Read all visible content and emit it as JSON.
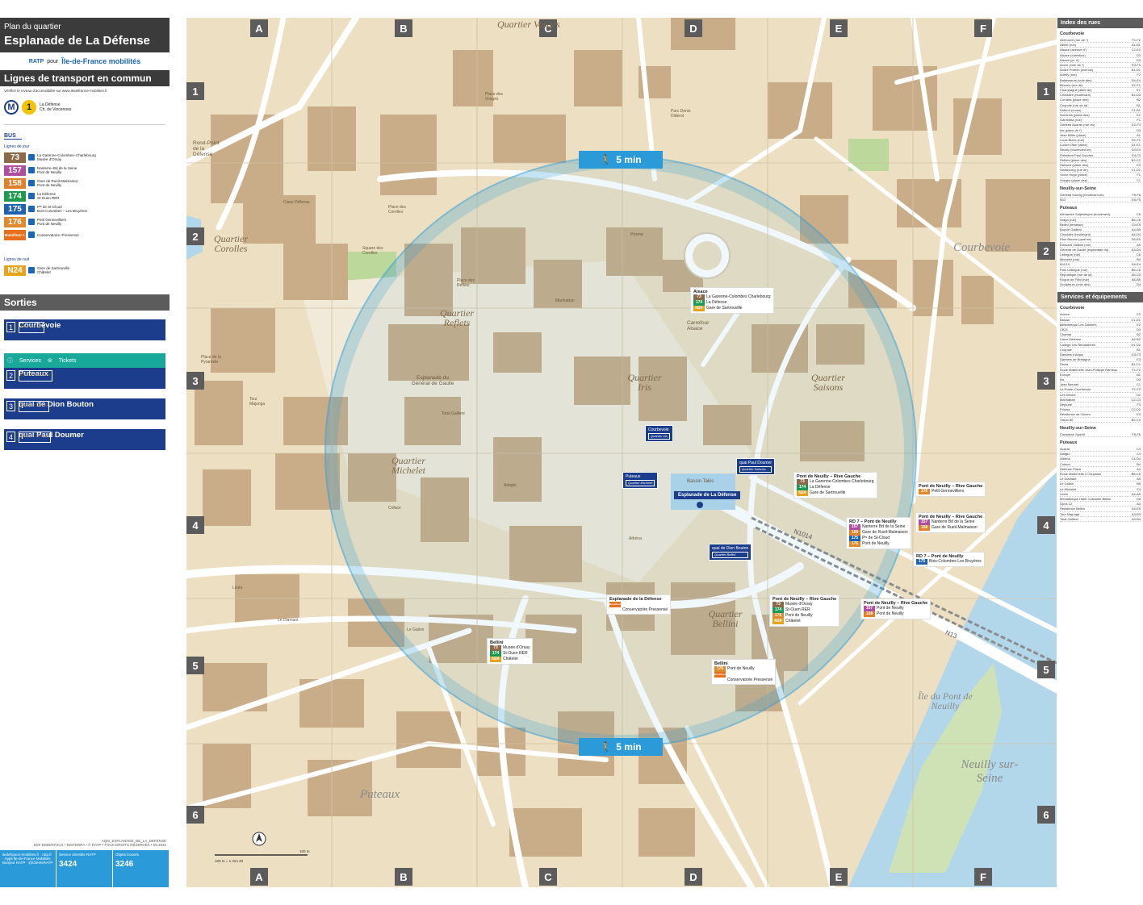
{
  "header": {
    "subtitle": "Plan du quartier",
    "title": "Esplanade de La Défense",
    "operator": "RATP",
    "operator_word": "pour",
    "authority": "Île-de-France mobilités"
  },
  "transport": {
    "section_title": "Lignes de transport en commun",
    "access_note": "Vérifiez le niveau d'accessibilité sur www.iledefrance-mobilites.fr",
    "metro": {
      "line": "1",
      "dest1": "La Défense",
      "dest2": "Ch. de Vincennes"
    },
    "bus_label": "BUS",
    "day_label": "Lignes de jour",
    "night_label": "Lignes de nuit",
    "bus_lines": [
      {
        "num": "73",
        "color": "#8a6a48",
        "dest1": "La Garenne-Colombes–Charlebourg",
        "dest2": "Musée d'Orsay"
      },
      {
        "num": "157",
        "color": "#b04fa0",
        "dest1": "Nanterre–Bd de la Seine",
        "dest2": "Pont de Neuilly"
      },
      {
        "num": "158",
        "color": "#e2802a",
        "dest1": "Gare de Rueil-Malmaison",
        "dest2": "Pont de Neuilly"
      },
      {
        "num": "174",
        "color": "#1d9a4e",
        "dest1": "La Défense",
        "dest2": "St-Ouen RER"
      },
      {
        "num": "175",
        "color": "#1e63b0",
        "dest1": "Pᵗᵉ de St-Cloud",
        "dest2": "Bois-Colombes – Les Bruyères"
      },
      {
        "num": "176",
        "color": "#e08a2c",
        "dest1": "Petit Gennevilliers",
        "dest2": "Pont de Neuilly"
      },
      {
        "num": "Buséfinor 1",
        "color": "#e8701d",
        "dest1": "Conservatoire–Pressensé",
        "dest2": ""
      }
    ],
    "night_lines": [
      {
        "num": "N24",
        "color": "#e8a21d",
        "dest1": "Gare de Sartrouville",
        "dest2": "Châtelet"
      }
    ]
  },
  "sorties": {
    "section_title": "Sorties",
    "services_label": "Services",
    "tickets_label": "Tickets",
    "items": [
      {
        "n": "1",
        "name": "Courbevoie",
        "quarter": "Quartier Iris"
      },
      {
        "n": "2",
        "name": "Puteaux",
        "quarter": "Quartier Michelet"
      },
      {
        "n": "3",
        "name": "quai de Dion Bouton",
        "quarter": "Quartier Bellini"
      },
      {
        "n": "4",
        "name": "quai Paul Doumer",
        "quarter": "Quartier Saisons"
      }
    ]
  },
  "credits": {
    "line1": "AQM_ESPLANADE_DE_LA_DEFENSE",
    "line2": "DSF-DMD/RIVICS • EDITERRA • © RATP • TOUS DROITS RÉSERVÉS • 05.2021"
  },
  "contact": {
    "col1": "iledefrance-mobilites.fr · ratp.fr · Appli Île-de-France Mobilités Bonjour RATP · @ClientsRATP",
    "svc_title": "Service clientèle RATP",
    "svc_num": "3424",
    "lost_title": "Objets trouvés",
    "lost_num": "3246"
  },
  "map": {
    "columns": [
      "A",
      "B",
      "C",
      "D",
      "E",
      "F"
    ],
    "rows": [
      "1",
      "2",
      "3",
      "4",
      "5",
      "6"
    ],
    "walk_label": "5 min",
    "quarters": [
      {
        "name": "Quartier Vosges"
      },
      {
        "name": "Quartier Corolles"
      },
      {
        "name": "Quartier Reflets"
      },
      {
        "name": "Quartier Iris"
      },
      {
        "name": "Quartier Saisons"
      },
      {
        "name": "Quartier Michelet"
      },
      {
        "name": "Quartier Bellini"
      }
    ],
    "towns": [
      "Courbevoie",
      "Puteaux",
      "Neuilly sur-Seine",
      "Île du Pont de Neuilly"
    ],
    "places": [
      "Esplanade du Général de Gaulle",
      "Bassin Takis",
      "Carrefour Alsace",
      "Rond-Point de la Défense",
      "N1014",
      "N13",
      "Place des Corolles",
      "Cœur Défense",
      "Square des Corolles",
      "Place des Reflets",
      "Place des Vosges",
      "Parc Denis Diderot",
      "Place de la Pyramide",
      "Le Diamant",
      "Le Galion",
      "Tour Majunga",
      "Linéa",
      "Prisma",
      "Manhattan",
      "Total Gallieni",
      "Coface",
      "Adagio",
      "Athéna"
    ],
    "esplanade_label": "Esplanade de La Défense",
    "stops": [
      {
        "name": "Alsace",
        "lines": [
          "73",
          "174",
          "N24"
        ],
        "dests": [
          "La Garenne-Colombes Charlebourg",
          "La Défense",
          "Gare de Sartrouville"
        ]
      },
      {
        "name": "Pont de Neuilly – Rive Gauche",
        "lines": [
          "73",
          "174",
          "N24"
        ],
        "dests": [
          "La Garenne-Colombes Charlebourg",
          "La Défense",
          "Gare de Sartrouville"
        ]
      },
      {
        "name": "Pont de Neuilly – Rive Gauche",
        "lines": [
          "176"
        ],
        "dests": [
          "Petit Gennevilliers"
        ]
      },
      {
        "name": "Pont de Neuilly – Rive Gauche",
        "lines": [
          "157",
          "158"
        ],
        "dests": [
          "Nanterre Bd de la Seine",
          "Gare de Rueil-Malmaison"
        ]
      },
      {
        "name": "RD 7 – Pont de Neuilly",
        "lines": [
          "157",
          "158",
          "175",
          "176"
        ],
        "dests": [
          "Nanterre Bd de la Seine",
          "Gare de Rueil-Malmaison",
          "Pᵗᵉ de St-Cloud",
          "Pont de Neuilly"
        ]
      },
      {
        "name": "RD 7 – Pont de Neuilly",
        "lines": [
          "175"
        ],
        "dests": [
          "Bois-Colombes Les Bruyères"
        ]
      },
      {
        "name": "Pont de Neuilly – Rive Gauche",
        "lines": [
          "73",
          "174",
          "176",
          "N24"
        ],
        "dests": [
          "Musée d'Orsay",
          "St-Ouen RER",
          "Pont de Neuilly",
          "Châtelet"
        ]
      },
      {
        "name": "Pont de Neuilly – Rive Gauche",
        "lines": [
          "157",
          "158"
        ],
        "dests": [
          "Pont de Neuilly",
          "Pont de Neuilly"
        ]
      },
      {
        "name": "Bellini",
        "lines": [
          "73",
          "174",
          "N24"
        ],
        "dests": [
          "Musée d'Orsay",
          "St-Ouen RER",
          "Châtelet"
        ]
      },
      {
        "name": "Bellini",
        "lines": [
          "176",
          "Buséfinor 1"
        ],
        "dests": [
          "Pont de Neuilly",
          "Conservatoire Pressensé"
        ]
      },
      {
        "name": "Esplanade de la Défense",
        "lines": [
          "Buséfinor 1"
        ],
        "dests": [
          "Conservatoire Pressensé"
        ]
      }
    ],
    "scale": "100 m",
    "scale_note": "100 m = 1 mm 20"
  },
  "index": {
    "title": "Index des rues",
    "sections": [
      {
        "name": "Courbevoie",
        "rows": [
          [
            "Abreuvoir (rue de l')",
            "F1-F2"
          ],
          [
            "Albert (rue)",
            "A1-B1"
          ],
          [
            "Alsace (avenue d')",
            "C2-E2"
          ],
          [
            "Alsace (carrefour)",
            "D3"
          ],
          [
            "Alsace (pl. d')",
            "D3"
          ],
          [
            "Ancre (voie de l')",
            "E3-F3"
          ],
          [
            "André Prothin (avenue)",
            "B1-D1"
          ],
          [
            "Arletty (rue)",
            "F2"
          ],
          [
            "Bataisseurs (voie des)",
            "D4-E4"
          ],
          [
            "Bezons (rue de)",
            "E1-F1"
          ],
          [
            "Champagne (allée de)",
            "E1"
          ],
          [
            "Circulaire (boulevard)",
            "B1-D3"
          ],
          [
            "Corolles (place des)",
            "B2"
          ],
          [
            "Coupole (rue de la)",
            "B1"
          ],
          [
            "Diderot (cours)",
            "C1-D1"
          ],
          [
            "Dominos (place des)",
            "E2"
          ],
          [
            "Gambetta (rue)",
            "F1"
          ],
          [
            "Général Audran (rue du)",
            "E2-F3"
          ],
          [
            "Iris (place de l')",
            "D3"
          ],
          [
            "Jean Millet (place)",
            "A1"
          ],
          [
            "Louis Blanc (rue)",
            "D1-F1"
          ],
          [
            "Lucien Otter (allée)",
            "D1-E1"
          ],
          [
            "Neuilly (boulevard de)",
            "D3-E4"
          ],
          [
            "Président Paul Doumer",
            "E4-F3"
          ],
          [
            "Reflets (place des)",
            "B2-C2"
          ],
          [
            "Saisons (place des)",
            "E3"
          ],
          [
            "Strasbourg (rue de)",
            "C1-D1"
          ],
          [
            "Victor Hugo (place)",
            "F1"
          ],
          [
            "Vosges (place des)",
            "C1"
          ]
        ]
      },
      {
        "name": "Neuilly-sur-Seine",
        "rows": [
          [
            "Général Koenig (boulevard du)",
            "F5-F6"
          ],
          [
            "N13",
            "E5-F5"
          ]
        ]
      },
      {
        "name": "Puteaux",
        "rows": [
          [
            "Alexandre Soljenitsyne (boulevard)",
            "C6"
          ],
          [
            "Arago (rue)",
            "B6-C6"
          ],
          [
            "Bellini (terrasse)",
            "C5-E5"
          ],
          [
            "Boucle Gallieni",
            "A4-B5"
          ],
          [
            "Circulaire (boulevard)",
            "A4-D4"
          ],
          [
            "Dion Bouton (quai de)",
            "D5-E5"
          ],
          [
            "Édouard Vaillant (rue)",
            "A5"
          ],
          [
            "Général de Gaulle (esplanade du)",
            "A3-D4"
          ],
          [
            "Lafargue (rue)",
            "C6"
          ],
          [
            "Michelet (rue)",
            "B4"
          ],
          [
            "N1014",
            "D4-E4"
          ],
          [
            "Paul Lafargue (rue)",
            "B6-C6"
          ],
          [
            "République (rue de la)",
            "A5-C5"
          ],
          [
            "Roque de Fillol (rue)",
            "A6-B5"
          ],
          [
            "Sculpteurs (voie des)",
            "D4"
          ]
        ]
      }
    ],
    "services_title": "Services et équipements",
    "services": [
      {
        "name": "Courbevoie",
        "rows": [
          [
            "Aurore",
            "C2"
          ],
          [
            "Balzac",
            "C1-D1"
          ],
          [
            "Bibliothèque Les Damiers",
            "E2"
          ],
          [
            "CB21",
            "D3"
          ],
          [
            "Charras",
            "B2"
          ],
          [
            "Cœur Défense",
            "A2-B2"
          ],
          [
            "Collège Les Renardières",
            "D1-D2"
          ],
          [
            "Coupole",
            "B1"
          ],
          [
            "Damiers d'Anjou",
            "E3-F3"
          ],
          [
            "Damiers de Bretagne",
            "E3"
          ],
          [
            "Dexia",
            "B1-C1"
          ],
          [
            "École Maternelle Jean-Philippe Rameau",
            "F1-F2"
          ],
          [
            "Europe",
            "B1"
          ],
          [
            "Iris",
            "D3"
          ],
          [
            "Jean Monnet",
            "C1"
          ],
          [
            "La Poste–Courbevoie",
            "F1-F2"
          ],
          [
            "Les Miroirs",
            "D2"
          ],
          [
            "Manhattan",
            "C2-C3"
          ],
          [
            "Neptune",
            "F3"
          ],
          [
            "Prisma",
            "C2-D2"
          ],
          [
            "Résidence de l'Ancre",
            "E3"
          ],
          [
            "Vision 80",
            "B2-C3"
          ]
        ]
      },
      {
        "name": "Neuilly-sur-Seine",
        "rows": [
          [
            "Complexe Sportif",
            "F5-F6"
          ]
        ]
      },
      {
        "name": "Puteaux",
        "rows": [
          [
            "Acacia",
            "C4"
          ],
          [
            "Adagio",
            "C4"
          ],
          [
            "Athéna",
            "C4-D4"
          ],
          [
            "Coface",
            "B4"
          ],
          [
            "Defense Plaza",
            "A4"
          ],
          [
            "École Maternelle 2 Coupoles",
            "B6-C6"
          ],
          [
            "Le Diamant",
            "A5"
          ],
          [
            "Le Galion",
            "B5"
          ],
          [
            "Le Michelet",
            "C4"
          ],
          [
            "Linéa",
            "A4-A5"
          ],
          [
            "Médiathèque Halle Culturelle Bellini",
            "D6"
          ],
          [
            "Opus 12",
            "A3"
          ],
          [
            "Résidence Bellini",
            "D4-E5"
          ],
          [
            "Tour Majunga",
            "A3-B3"
          ],
          [
            "Total Gallieni",
            "A3-B4"
          ]
        ]
      }
    ]
  }
}
